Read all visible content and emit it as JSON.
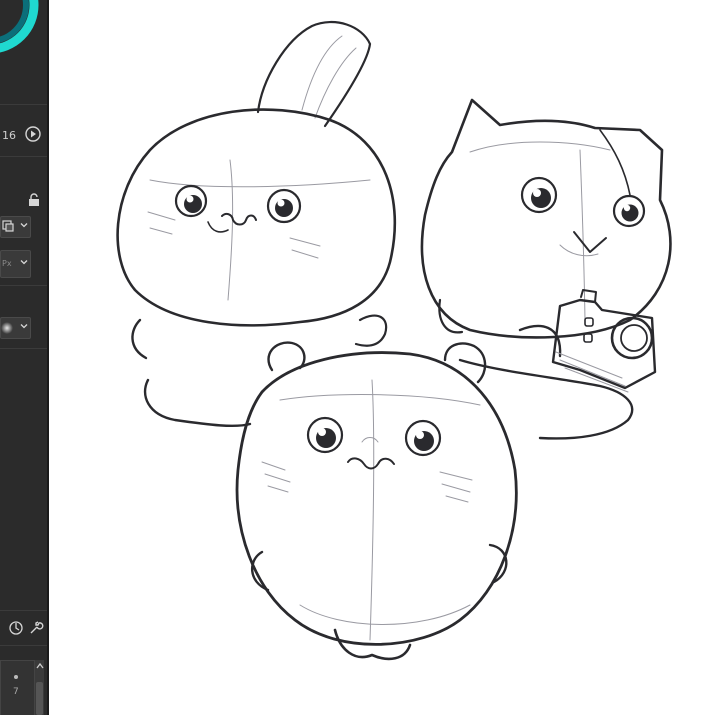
{
  "sidebar": {
    "brush_size_value": "16",
    "color_wheel_colors": {
      "outer": "#1fd9d0",
      "inner": "#0b6f7a"
    },
    "unit_label": "Px",
    "scroll_counter": "7",
    "panel_bg": "#2b2b2b"
  },
  "canvas": {
    "background": "#ffffff",
    "subject": [
      "rabbit-character",
      "cat-character-with-camera",
      "hamster-character"
    ]
  }
}
